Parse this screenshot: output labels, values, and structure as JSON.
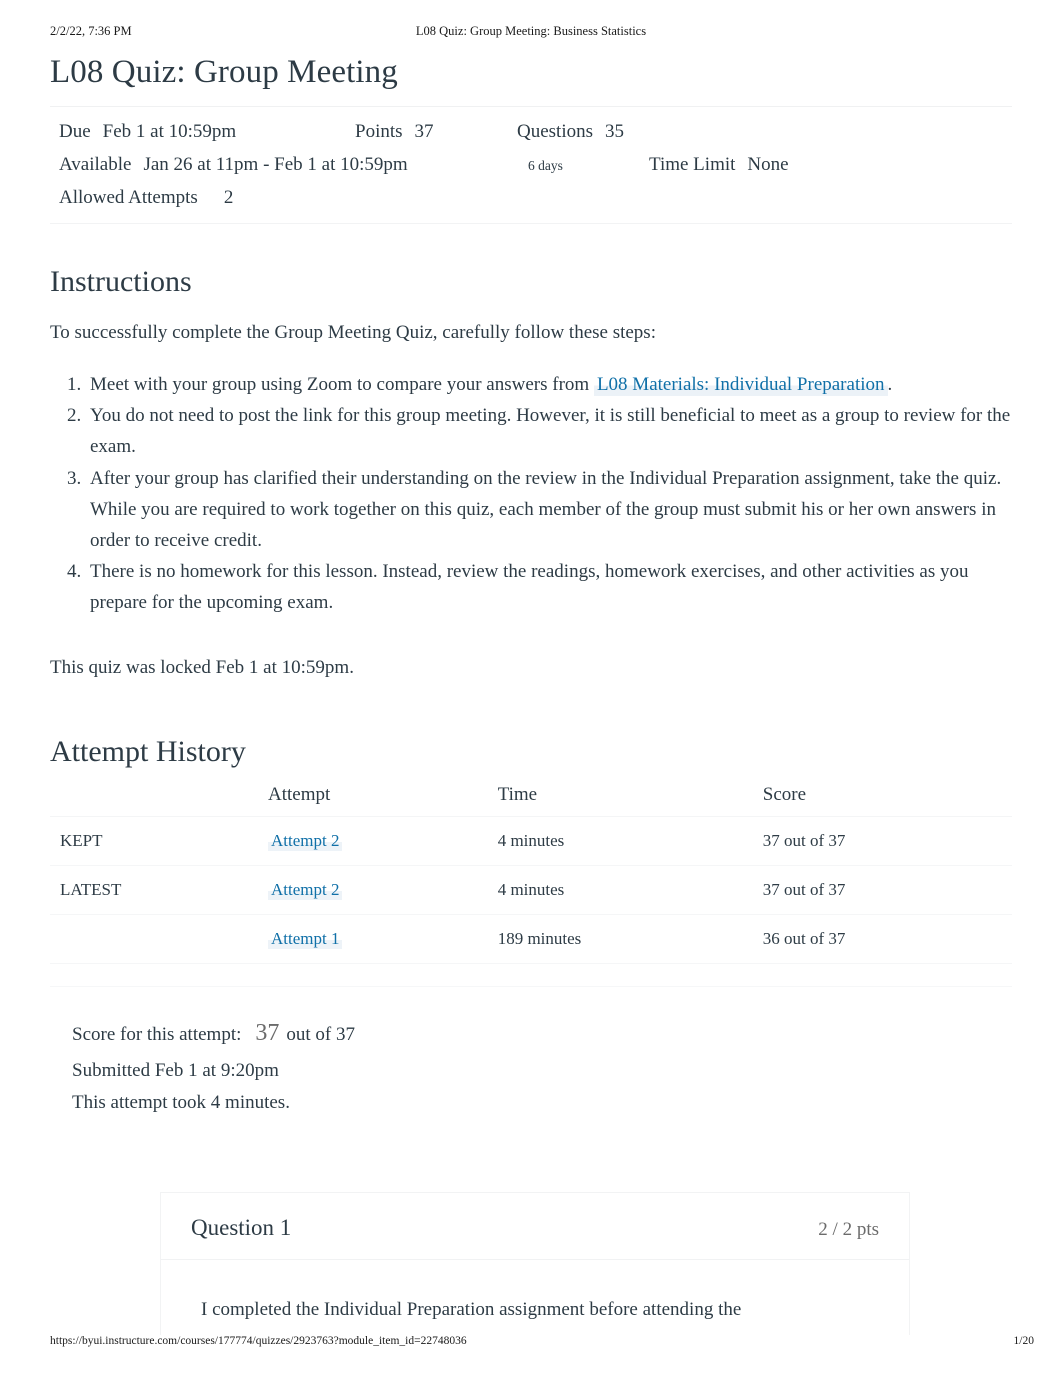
{
  "print_header": {
    "left": "2/2/22, 7:36 PM",
    "center": "L08 Quiz: Group Meeting: Business Statistics"
  },
  "print_footer": {
    "url": "https://byui.instructure.com/courses/177774/quizzes/2923763?module_item_id=22748036",
    "page": "1/20"
  },
  "quiz": {
    "title": "L08 Quiz: Group Meeting",
    "meta": {
      "due_label": "Due",
      "due_value": "Feb 1 at 10:59pm",
      "points_label": "Points",
      "points_value": "37",
      "questions_label": "Questions",
      "questions_value": "35",
      "available_label": "Available",
      "available_value": "Jan 26 at 11pm - Feb 1 at 10:59pm",
      "available_duration": "6 days",
      "time_limit_label": "Time Limit",
      "time_limit_value": "None",
      "allowed_attempts_label": "Allowed Attempts",
      "allowed_attempts_value": "2"
    }
  },
  "instructions": {
    "heading": "Instructions",
    "intro": "To successfully complete the Group Meeting Quiz, carefully follow these steps:",
    "steps": [
      {
        "before": "Meet with your group using Zoom to compare your answers from ",
        "link": "L08 Materials: Individual Preparation",
        "after": "."
      },
      {
        "text": "You do not need to post the link for this group meeting. However, it is still beneficial to meet as a group to review for the exam."
      },
      {
        "text": "After your group has clarified their understanding on the review in the Individual Preparation assignment, take the quiz. While you are required to work together on this quiz, each member of the group must submit his or her own answers in order to receive credit."
      },
      {
        "text": "There is no homework for this lesson. Instead, review the readings, homework exercises, and other activities as you prepare for the upcoming exam."
      }
    ],
    "locked_notice": "This quiz was locked Feb 1 at 10:59pm."
  },
  "attempt_history": {
    "heading": "Attempt History",
    "columns": {
      "flag": "",
      "attempt": "Attempt",
      "time": "Time",
      "score": "Score"
    },
    "rows": [
      {
        "flag": "KEPT",
        "attempt": "Attempt 2",
        "time": "4 minutes",
        "score": "37 out of 37"
      },
      {
        "flag": "LATEST",
        "attempt": "Attempt 2",
        "time": "4 minutes",
        "score": "37 out of 37"
      },
      {
        "flag": "",
        "attempt": "Attempt 1",
        "time": "189 minutes",
        "score": "36 out of 37"
      }
    ]
  },
  "score_summary": {
    "score_label": "Score for this attempt:",
    "score_value": "37",
    "score_suffix": "out of 37",
    "submitted": "Submitted Feb 1 at 9:20pm",
    "duration": "This attempt took 4 minutes."
  },
  "question": {
    "name": "Question 1",
    "points": "2 / 2 pts",
    "text": "I completed the Individual Preparation assignment before attending the"
  },
  "colors": {
    "link": "#1070a8",
    "text": "#2d3b45",
    "muted": "#6b6b6b",
    "rule": "#f2f3f4"
  }
}
